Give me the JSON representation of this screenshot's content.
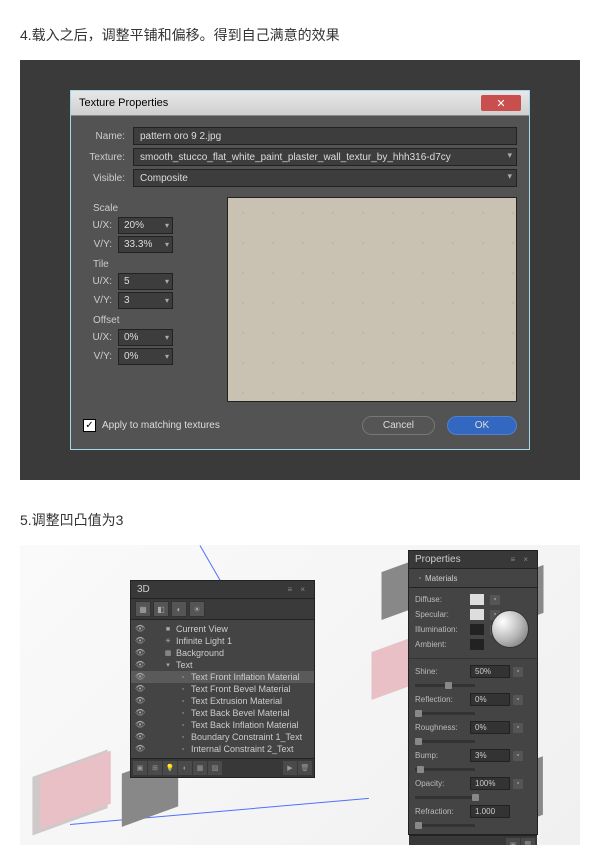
{
  "step4": "4.载入之后，调整平铺和偏移。得到自己满意的效果",
  "step5": "5.调整凹凸值为3",
  "dlg": {
    "title": "Texture Properties",
    "name_lbl": "Name:",
    "name_val": "pattern oro 9 2.jpg",
    "texture_lbl": "Texture:",
    "texture_val": "smooth_stucco_flat_white_paint_plaster_wall_textur_by_hhh316-d7cy",
    "visible_lbl": "Visible:",
    "visible_val": "Composite",
    "scale": "Scale",
    "tile": "Tile",
    "offset": "Offset",
    "ux": "U/X:",
    "vy": "V/Y:",
    "scale_ux": "20%",
    "scale_vy": "33.3%",
    "tile_ux": "5",
    "tile_vy": "3",
    "offset_ux": "0%",
    "offset_vy": "0%",
    "apply": "Apply to matching textures",
    "cancel": "Cancel",
    "ok": "OK"
  },
  "p3d": {
    "title": "3D",
    "items": [
      {
        "icon": "■",
        "label": "Current View",
        "indent": 1
      },
      {
        "icon": "☀",
        "label": "Infinite Light 1",
        "indent": 1
      },
      {
        "icon": "▦",
        "label": "Background",
        "indent": 1
      },
      {
        "icon": "▾",
        "label": "Text",
        "indent": 1
      },
      {
        "icon": "▫",
        "label": "Text Front Inflation Material",
        "indent": 2,
        "sel": true
      },
      {
        "icon": "▫",
        "label": "Text Front Bevel Material",
        "indent": 2
      },
      {
        "icon": "▫",
        "label": "Text Extrusion Material",
        "indent": 2
      },
      {
        "icon": "▫",
        "label": "Text Back Bevel Material",
        "indent": 2
      },
      {
        "icon": "▫",
        "label": "Text Back Inflation Material",
        "indent": 2
      },
      {
        "icon": "▫",
        "label": "Boundary Constraint 1_Text",
        "indent": 2
      },
      {
        "icon": "▫",
        "label": "Internal Constraint 2_Text",
        "indent": 2
      }
    ]
  },
  "props": {
    "title": "Properties",
    "materials": "Materials",
    "diffuse": "Diffuse:",
    "specular": "Specular:",
    "illumination": "Illumination:",
    "ambient": "Ambient:",
    "shine": "Shine:",
    "shine_v": "50%",
    "reflection": "Reflection:",
    "reflection_v": "0%",
    "roughness": "Roughness:",
    "roughness_v": "0%",
    "bump": "Bump:",
    "bump_v": "3%",
    "opacity": "Opacity:",
    "opacity_v": "100%",
    "refraction": "Refraction:",
    "refraction_v": "1.000"
  }
}
